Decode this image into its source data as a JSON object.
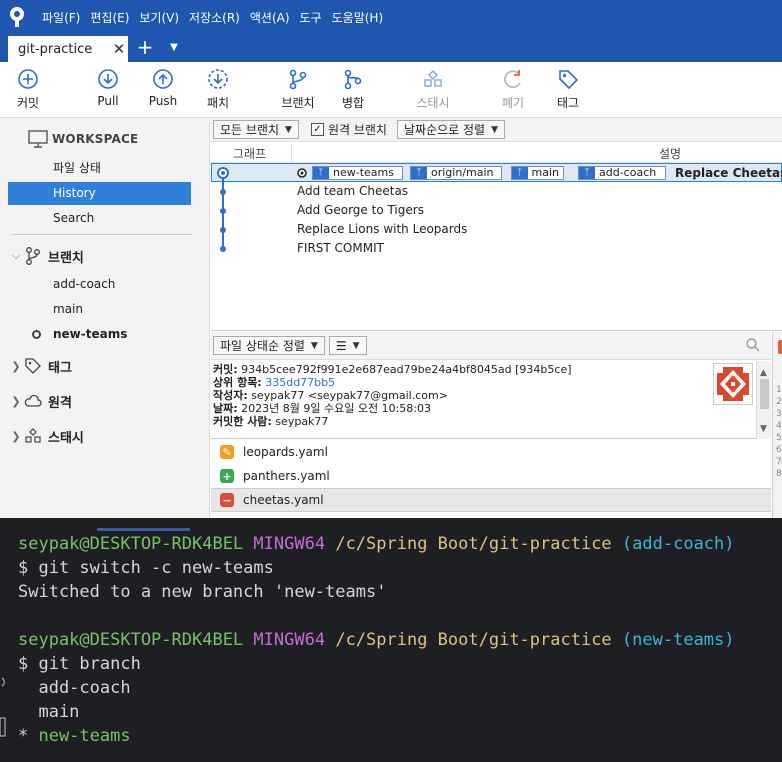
{
  "menubar": {
    "items": [
      "파일(F)",
      "편집(E)",
      "보기(V)",
      "저장소(R)",
      "액션(A)",
      "도구",
      "도움말(H)"
    ]
  },
  "tabs": {
    "active_label": "git-practice",
    "close_glyph": "✕",
    "add_glyph": "+",
    "menu_glyph": "▼"
  },
  "toolbar": {
    "commit": "커밋",
    "pull": "Pull",
    "push": "Push",
    "fetch": "패치",
    "branch": "브랜치",
    "merge": "병합",
    "stash": "스태시",
    "discard": "폐기",
    "tag": "태그"
  },
  "sidebar": {
    "workspace": "WORKSPACE",
    "file_status": "파일 상태",
    "history": "History",
    "search": "Search",
    "branches_header": "브랜치",
    "branches": [
      "add-coach",
      "main",
      "new-teams"
    ],
    "current_branch": "new-teams",
    "tags_header": "태그",
    "remotes_header": "원격",
    "stashes_header": "스태시"
  },
  "filterbar": {
    "all_branches": "모든 브랜치",
    "remote_branches_label": "원격 브랜치",
    "remote_branches_checked": true,
    "sort": "날짜순으로 정렬"
  },
  "commit_list": {
    "col_graph": "그래프",
    "col_description": "설명",
    "refs": [
      "new-teams",
      "origin/main",
      "main",
      "add-coach"
    ],
    "commits": [
      "Replace Cheetas with Panthers",
      "Add team Cheetas",
      "Add George to Tigers",
      "Replace Lions with Leopards",
      "FIRST COMMIT"
    ],
    "selected_message_visible": "Replace Cheetas w"
  },
  "detailbar": {
    "sort": "파일 상태순 정렬",
    "view_glyph": "☰"
  },
  "commit_info": {
    "commit_label": "커밋:",
    "commit_hash": "934b5cee792f991e2e687ead79be24a4bf8045ad [934b5ce]",
    "parent_label": "상위 항목:",
    "parent_hash": "335dd77bb5",
    "author_label": "작성자:",
    "author": "seypak77 <seypak77@gmail.com>",
    "date_label": "날짜:",
    "date": "2023년 8월 9일 수요일 오전 10:58:03",
    "committer_label": "커밋한 사람:",
    "committer": "seypak77"
  },
  "files": [
    {
      "name": "leopards.yaml",
      "status": "modified",
      "color": "#f0a020",
      "glyph": "✎"
    },
    {
      "name": "panthers.yaml",
      "status": "added",
      "color": "#3aa757",
      "glyph": "+"
    },
    {
      "name": "cheetas.yaml",
      "status": "removed",
      "color": "#e04a3a",
      "glyph": "−"
    }
  ],
  "gutter_numbers": "1\n2\n3\n4\n5\n6\n7\n8",
  "terminal": {
    "lines": [
      {
        "user": "seypak@DESKTOP-RDK4BEL",
        "shell": "MINGW64",
        "path": "/c/Spring Boot/git-practice",
        "branch": "(add-coach)"
      },
      {
        "text": "$ git switch -c new-teams"
      },
      {
        "text": "Switched to a new branch 'new-teams'"
      },
      {
        "text": ""
      },
      {
        "user": "seypak@DESKTOP-RDK4BEL",
        "shell": "MINGW64",
        "path": "/c/Spring Boot/git-practice",
        "branch": "(new-teams)"
      },
      {
        "text": "$ git branch"
      },
      {
        "text": "  add-coach"
      },
      {
        "text": "  main"
      },
      {
        "text": "* ",
        "highlight": "new-teams"
      }
    ]
  },
  "colors": {
    "accent": "#1e56b0",
    "selection": "#2f80d8",
    "terminal_bg": "#1e1f22"
  }
}
